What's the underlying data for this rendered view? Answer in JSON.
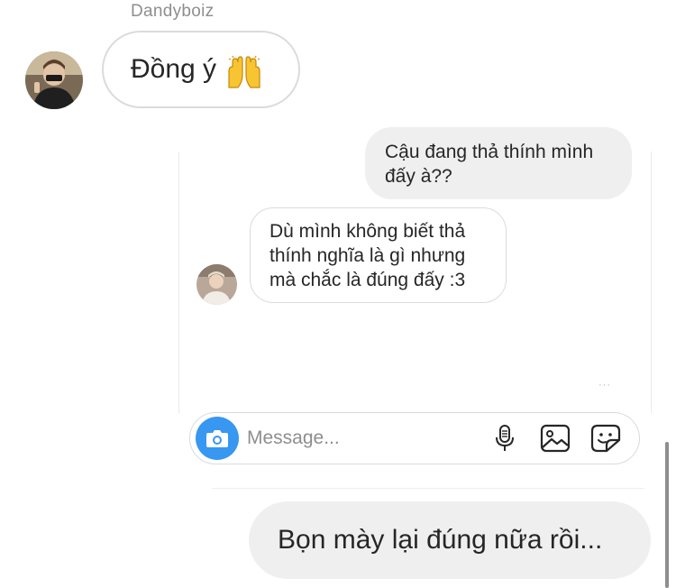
{
  "thread": {
    "sender_name": "Dandyboiz",
    "message_1": {
      "text": "Đồng ý",
      "emoji": "raising-hands-emoji"
    },
    "message_4": {
      "text": "Bọn mày lại đúng nữa rồi..."
    }
  },
  "embedded_chat": {
    "outgoing": "Cậu đang thả thính mình đấy à??",
    "incoming": "Dù mình không biết thả thính nghĩa là gì nhưng mà chắc là đúng đấy :3",
    "typing_dots": "···"
  },
  "composer": {
    "placeholder": "Message...",
    "icons": [
      "camera-icon",
      "microphone-icon",
      "gallery-icon",
      "sticker-icon"
    ]
  },
  "colors": {
    "accent": "#3897f0",
    "bubble_gray": "#efefef",
    "border": "#dbdbdb",
    "secondary_text": "#8e8e8e"
  }
}
